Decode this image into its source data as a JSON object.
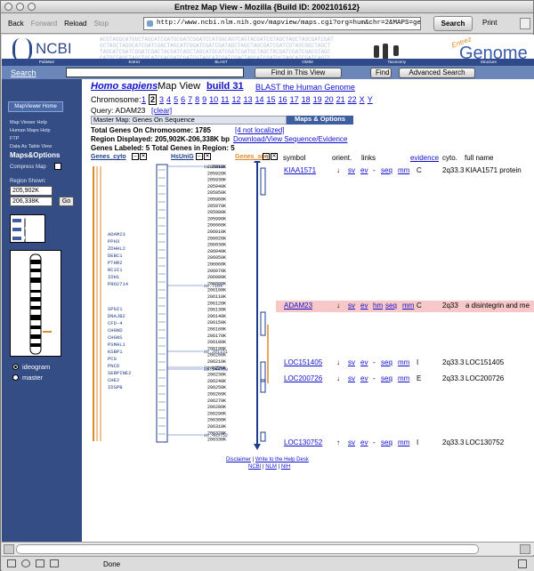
{
  "window": {
    "title": "Entrez Map View - Mozilla {Build ID: 2002101612}"
  },
  "toolbar": {
    "back": "Back",
    "forward": "Forward",
    "reload": "Reload",
    "stop": "Stop",
    "url": "http://www.ncbi.nlm.nih.gov/mapview/maps.cgi?org=hum&chr=2&MAPS=genec,ugHs,genes-",
    "search": "Search",
    "print": "Print"
  },
  "banner": {
    "logo": "NCBI",
    "entrez": "Entrez",
    "genome": "Genome",
    "nav": [
      "PubMed",
      "Entrez",
      "BLAST",
      "OMIM",
      "Taxonomy",
      "Structure"
    ]
  },
  "searchbar": {
    "label": "Search",
    "find_in_view": "Find in This View",
    "find": "Find",
    "advanced": "Advanced Search"
  },
  "sidebar": {
    "home": "MapViewer Home",
    "links": [
      "Map Viewer Help",
      "Human Maps Help",
      "FTP",
      "Data As Table View"
    ],
    "maps_options": "Maps&Options",
    "compress": "Compress Map",
    "region_shown": "Region Shown:",
    "from": "205,902K",
    "to": "206,338K",
    "go": "Go",
    "zoom": [
      "out",
      "zoom",
      "in"
    ],
    "radios": [
      "ideogram",
      "master"
    ]
  },
  "main": {
    "species": "Homo sapiens",
    "mapview": "Map View",
    "build": "build 31",
    "blast": "BLAST the Human Genome",
    "chr_label": "Chromosome:",
    "chromosomes": [
      "1",
      "2",
      "3",
      "4",
      "5",
      "6",
      "7",
      "8",
      "9",
      "10",
      "11",
      "12",
      "13",
      "14",
      "15",
      "16",
      "17",
      "18",
      "19",
      "20",
      "21",
      "22",
      "X",
      "Y"
    ],
    "query_label": "Query: ADAM23",
    "clear": "[clear]",
    "master_map": "Master Map: Genes On Sequence",
    "maps_options": "Maps & Options",
    "genes_on_chr": "Total Genes On Chromosome: 1785",
    "not_localized": "[4 not localized]",
    "region_displayed": "Region Displayed: 205,902K-206,338K bp",
    "download": "Download/View Sequence/Evidence",
    "genes_labeled": "Genes Labeled: 5 Total Genes in Region: 5",
    "tracks": {
      "cyto": "Genes_cyto",
      "unigene": "HsUniG",
      "seq": "Genes_seq"
    },
    "columns": {
      "symbol": "symbol",
      "orient": "orient.",
      "links": "links",
      "evidence": "evidence",
      "cyto": "cyto.",
      "full": "full name"
    },
    "genes": [
      {
        "symbol": "KIAA1571",
        "orient": "↓",
        "links": [
          "sv",
          "ev",
          "-",
          "seq",
          "mm"
        ],
        "evidence": "C",
        "cyto": "2q33.3",
        "full": "KIAA1571 protein"
      },
      {
        "symbol": "ADAM23",
        "orient": "↓",
        "links": [
          "sv",
          "ev",
          "hm",
          "seq",
          "mm"
        ],
        "evidence": "C",
        "cyto": "2q33",
        "full": "a disintegrin and me"
      },
      {
        "symbol": "LOC151405",
        "orient": "↓",
        "links": [
          "sv",
          "ev",
          "-",
          "seq",
          "mm"
        ],
        "evidence": "I",
        "cyto": "2q33.3",
        "full": "LOC151405"
      },
      {
        "symbol": "LOC200726",
        "orient": "↓",
        "links": [
          "sv",
          "ev",
          "-",
          "seq",
          "mm"
        ],
        "evidence": "E",
        "cyto": "2q33.3",
        "full": "LOC200726"
      },
      {
        "symbol": "LOC130752",
        "orient": "↑",
        "links": [
          "sv",
          "ev",
          "-",
          "seq",
          "mm"
        ],
        "evidence": "I",
        "cyto": "2q33.3",
        "full": "LOC130752"
      }
    ],
    "cyto_genes": [
      "ADAM23",
      "PPH3",
      "ZDHHL2",
      "DEBC1",
      "PTHR2",
      "RC3I1",
      "IDH1",
      "PRO2714",
      "SPGI1",
      "DNAJB2",
      "CFD-4",
      "CHGND",
      "CHGNS",
      "PSMAL1",
      "KSBP1",
      "PCG",
      "PNCD",
      "SERPINE2",
      "CHE2",
      "IDSPB"
    ],
    "unigene_labels": [
      "Hs.28888",
      "Hs.7164",
      "Hs.201151",
      "Hs.12514",
      "Hs.144769",
      "Hs.403752"
    ],
    "seq_scale": [
      "205910K",
      "205920K",
      "205930K",
      "205940K",
      "205950K",
      "205960K",
      "205970K",
      "205980K",
      "205990K",
      "206000K",
      "206010K",
      "206020K",
      "206030K",
      "206040K",
      "206050K",
      "206060K",
      "206070K",
      "206080K",
      "206090K",
      "206100K",
      "206110K",
      "206120K",
      "206130K",
      "206140K",
      "206150K",
      "206160K",
      "206170K",
      "206180K",
      "206190K",
      "206200K",
      "206210K",
      "206220K",
      "206230K",
      "206240K",
      "206250K",
      "206260K",
      "206270K",
      "206280K",
      "206290K",
      "206300K",
      "206310K",
      "206320K",
      "206330K"
    ],
    "footer": {
      "disclaimer": "Disclaimer",
      "write": "Write to the Help Desk",
      "ncbi": "NCBI",
      "nlm": "NLM",
      "nih": "NIH"
    }
  },
  "status": {
    "text": "Done"
  }
}
